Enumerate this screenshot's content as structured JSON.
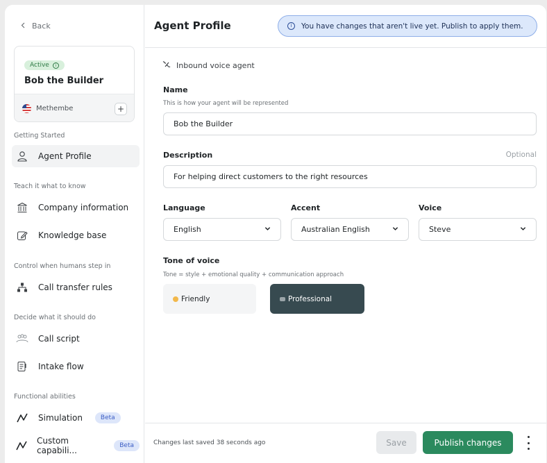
{
  "sidebar": {
    "back_label": "Back",
    "agent": {
      "status": "Active",
      "name": "Bob the Builder",
      "location": "Methembe"
    },
    "sections": {
      "getting_started": "Getting Started",
      "teach": "Teach it what to know",
      "control": "Control when humans step in",
      "decide": "Decide what it should do",
      "functional": "Functional abilities"
    },
    "items": {
      "agent_profile": "Agent Profile",
      "company_information": "Company information",
      "knowledge_base": "Knowledge base",
      "call_transfer_rules": "Call transfer rules",
      "call_script": "Call script",
      "intake_flow": "Intake flow",
      "simulation": "Simulation",
      "custom_capabilities": "Custom capabili...",
      "beta_label": "Beta"
    }
  },
  "header": {
    "title": "Agent Profile",
    "banner": "You have changes that aren't live yet. Publish to apply them."
  },
  "form": {
    "agent_type": "Inbound voice agent",
    "name": {
      "label": "Name",
      "help": "This is how your agent will be represented",
      "value": "Bob the Builder"
    },
    "description": {
      "label": "Description",
      "optional": "Optional",
      "value": "For helping direct customers to the right resources"
    },
    "language": {
      "label": "Language",
      "value": "English"
    },
    "accent": {
      "label": "Accent",
      "value": "Australian English"
    },
    "voice": {
      "label": "Voice",
      "value": "Steve"
    },
    "tone": {
      "label": "Tone of voice",
      "help": "Tone = style + emotional quality + communication approach",
      "options": [
        "Friendly",
        "Professional"
      ],
      "selected": "Professional"
    }
  },
  "footer": {
    "saved_text": "Changes last saved 38 seconds ago",
    "save_label": "Save",
    "publish_label": "Publish changes"
  },
  "colors": {
    "accent_green": "#2b8a5e",
    "banner_bg": "#dce8fb",
    "tone_selected": "#374a50",
    "beta_bg": "#dde6fa"
  }
}
